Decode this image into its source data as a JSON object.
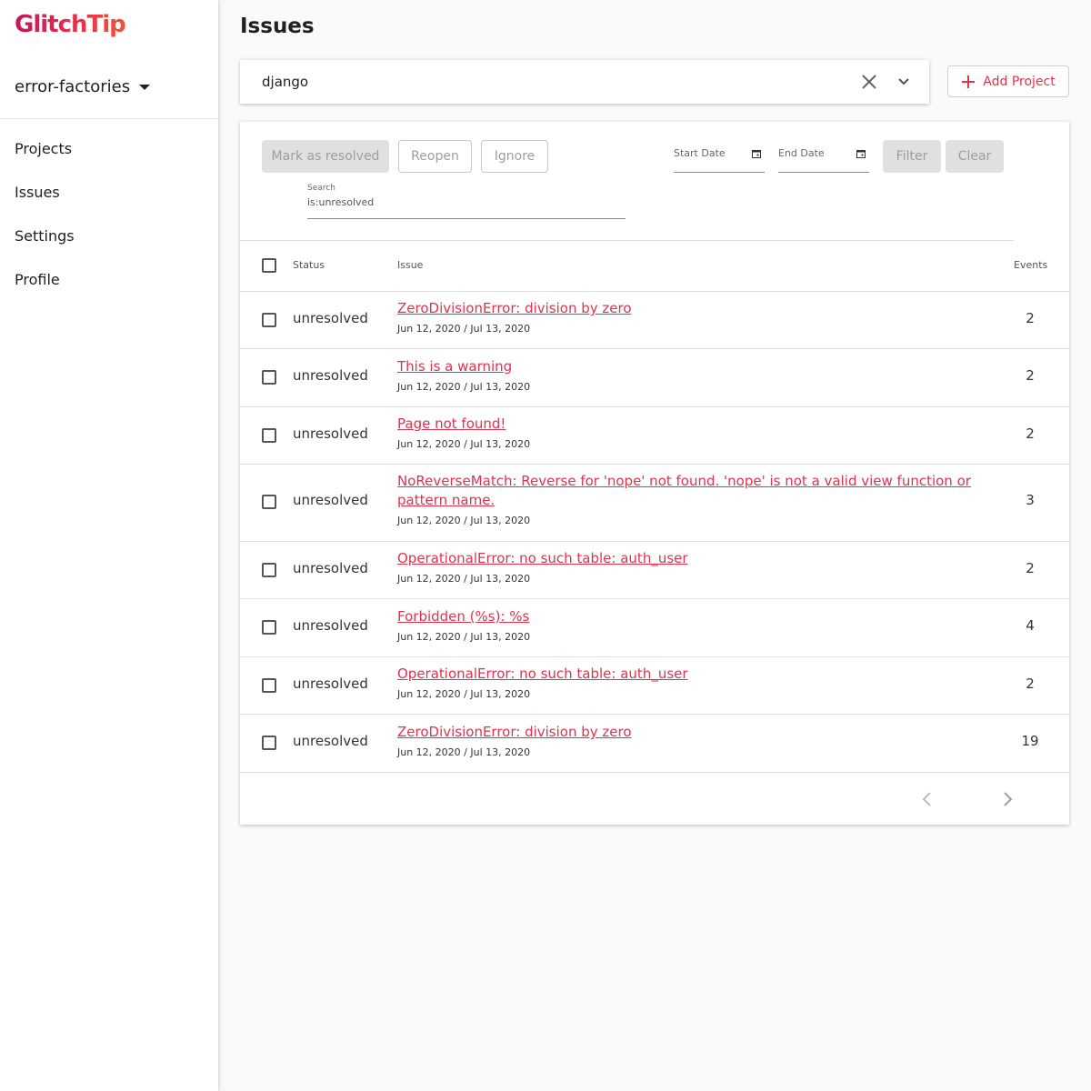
{
  "app": {
    "logo_text": "GlitchTip",
    "brand_color": "#e0334e"
  },
  "sidebar": {
    "org_name": "error-factories",
    "items": [
      {
        "label": "Projects"
      },
      {
        "label": "Issues"
      },
      {
        "label": "Settings"
      },
      {
        "label": "Profile"
      }
    ]
  },
  "page": {
    "title": "Issues"
  },
  "project_select": {
    "value": "django"
  },
  "add_project": {
    "label": "Add Project"
  },
  "toolbar": {
    "mark_resolved": "Mark as resolved",
    "reopen": "Reopen",
    "ignore": "Ignore",
    "start_date": "Start Date",
    "end_date": "End Date",
    "filter": "Filter",
    "clear": "Clear"
  },
  "search": {
    "label": "Search",
    "value": "is:unresolved"
  },
  "table": {
    "headers": {
      "status": "Status",
      "issue": "Issue",
      "events": "Events"
    },
    "rows": [
      {
        "status": "unresolved",
        "title": "ZeroDivisionError: division by zero",
        "dates": "Jun 12, 2020 / Jul 13, 2020",
        "events": "2"
      },
      {
        "status": "unresolved",
        "title": "This is a warning",
        "dates": "Jun 12, 2020 / Jul 13, 2020",
        "events": "2"
      },
      {
        "status": "unresolved",
        "title": "Page not found!",
        "dates": "Jun 12, 2020 / Jul 13, 2020",
        "events": "2"
      },
      {
        "status": "unresolved",
        "title": "NoReverseMatch: Reverse for 'nope' not found. 'nope' is not a valid view function or pattern name.",
        "dates": "Jun 12, 2020 / Jul 13, 2020",
        "events": "3"
      },
      {
        "status": "unresolved",
        "title": "OperationalError: no such table: auth_user",
        "dates": "Jun 12, 2020 / Jul 13, 2020",
        "events": "2"
      },
      {
        "status": "unresolved",
        "title": "Forbidden (%s): %s",
        "dates": "Jun 12, 2020 / Jul 13, 2020",
        "events": "4"
      },
      {
        "status": "unresolved",
        "title": "OperationalError: no such table: auth_user",
        "dates": "Jun 12, 2020 / Jul 13, 2020",
        "events": "2"
      },
      {
        "status": "unresolved",
        "title": "ZeroDivisionError: division by zero",
        "dates": "Jun 12, 2020 / Jul 13, 2020",
        "events": "19"
      }
    ]
  },
  "icons": {
    "org_dropdown": "caret-down-icon",
    "project_clear": "close-icon",
    "project_expand": "chevron-down-icon",
    "add": "plus-icon",
    "calendar": "calendar-icon",
    "prev": "chevron-left-icon",
    "next": "chevron-right-icon"
  }
}
